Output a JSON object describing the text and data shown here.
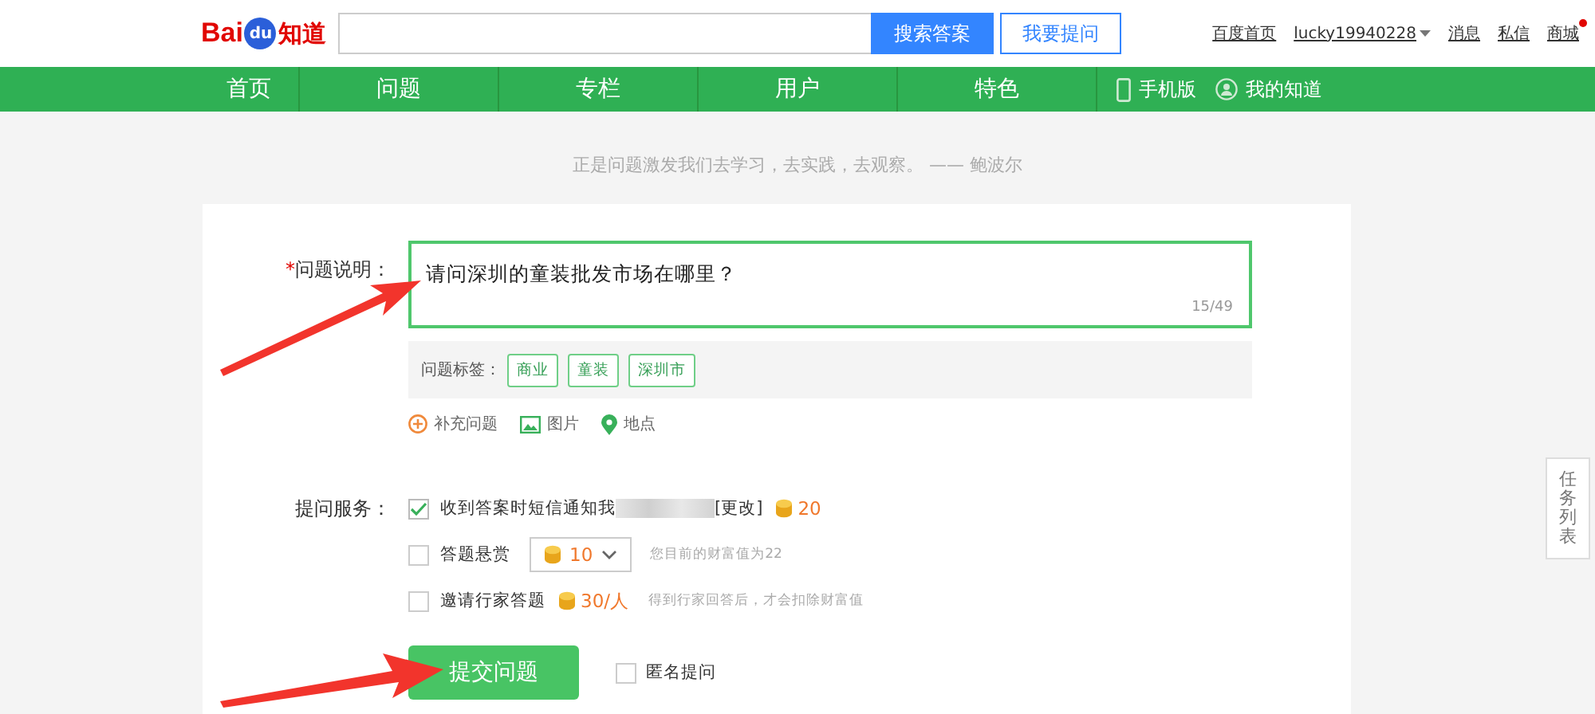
{
  "header": {
    "logo": {
      "left": "Bai",
      "mark": "du",
      "right": "知道"
    },
    "search": {
      "button": "搜索答案"
    },
    "ask_button": "我要提问",
    "links": [
      {
        "label": "百度首页",
        "kind": "plain"
      },
      {
        "label": "lucky19940228",
        "kind": "menu"
      },
      {
        "label": "消息",
        "kind": "plain"
      },
      {
        "label": "私信",
        "kind": "plain"
      },
      {
        "label": "商城",
        "kind": "dot"
      }
    ]
  },
  "nav": {
    "items": [
      {
        "label": "首页",
        "kind": "plain"
      },
      {
        "label": "问题",
        "kind": "plain"
      },
      {
        "label": "专栏",
        "kind": "plain"
      },
      {
        "label": "用户",
        "kind": "plain"
      },
      {
        "label": "特色",
        "kind": "plain"
      },
      {
        "label": "手机版",
        "kind": "phone"
      },
      {
        "label": "我的知道",
        "kind": "user"
      }
    ]
  },
  "quote": "正是问题激发我们去学习，去实践，去观察。 —— 鲍波尔",
  "form": {
    "question": {
      "required_mark": "*",
      "label": "问题说明：",
      "value": "请问深圳的童装批发市场在哪里？",
      "counter": "15/49"
    },
    "tags": {
      "label": "问题标签：",
      "items": [
        "商业",
        "童装",
        "深圳市"
      ]
    },
    "extras": [
      {
        "label": "补充问题",
        "kind": "add"
      },
      {
        "label": "图片",
        "kind": "image"
      },
      {
        "label": "地点",
        "kind": "pin"
      }
    ],
    "services": {
      "label": "提问服务：",
      "items": [
        {
          "kind": "sms",
          "checked": true,
          "label": "收到答案时短信通知我",
          "link": "[更改]",
          "cost": "20"
        },
        {
          "kind": "reward",
          "checked": false,
          "label": "答题悬赏",
          "cost": "10",
          "hint": "您目前的财富值为22"
        },
        {
          "kind": "expert",
          "checked": false,
          "label": "邀请行家答题",
          "cost": "30/人",
          "hint": "得到行家回答后，才会扣除财富值"
        }
      ]
    },
    "submit": "提交问题",
    "anonymous": {
      "label": "匿名提问",
      "checked": false
    }
  },
  "side_tab": "任务列表"
}
